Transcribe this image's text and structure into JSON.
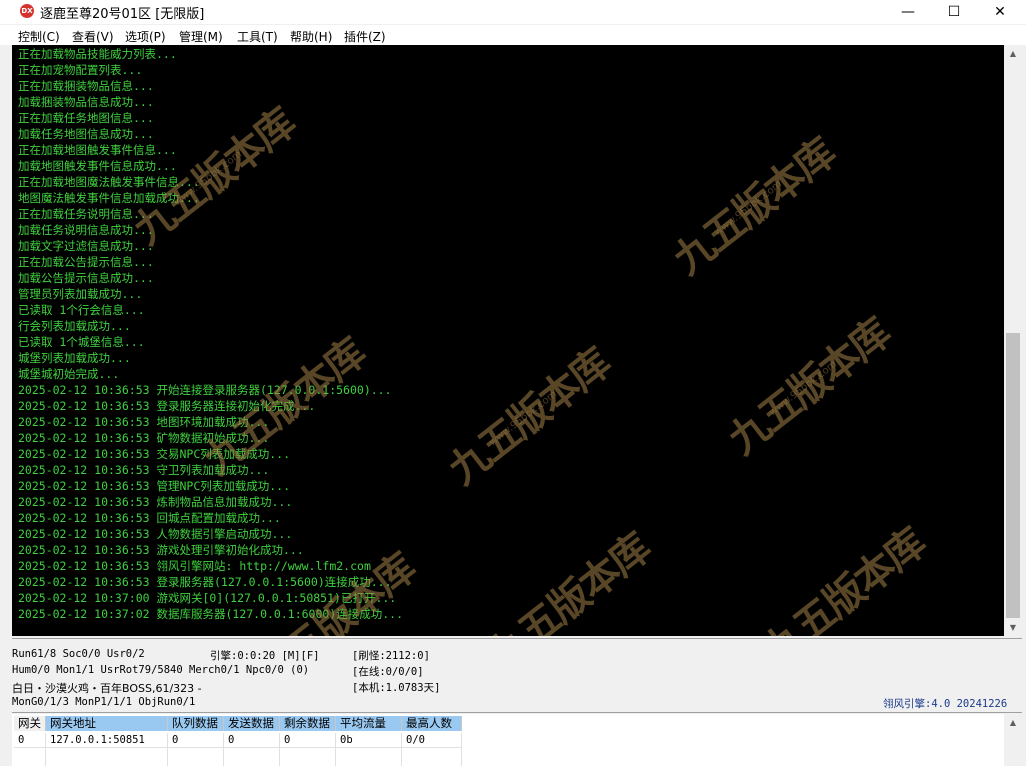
{
  "window": {
    "title": "逐鹿至尊20号01区 [无限版]",
    "icon_label": "DX",
    "minimize": "—",
    "maximize": "☐",
    "close": "✕"
  },
  "menu": [
    {
      "label": "控制(C)"
    },
    {
      "label": "查看(V)"
    },
    {
      "label": "选项(P)"
    },
    {
      "label": "管理(M)"
    },
    {
      "label": "工具(T)"
    },
    {
      "label": "帮助(H)"
    },
    {
      "label": "插件(Z)"
    }
  ],
  "log": [
    "正在加载物品技能威力列表...",
    "正在加宠物配置列表...",
    "正在加载捆装物品信息...",
    "加载捆装物品信息成功...",
    "正在加载任务地图信息...",
    "加载任务地图信息成功...",
    "正在加载地图触发事件信息...",
    "加载地图触发事件信息成功...",
    "正在加载地图魔法触发事件信息...",
    "地图魔法触发事件信息加载成功...",
    "正在加载任务说明信息...",
    "加载任务说明信息成功...",
    "加载文字过滤信息成功...",
    "正在加载公告提示信息...",
    "加载公告提示信息成功...",
    "管理员列表加载成功...",
    "已读取 1个行会信息...",
    "行会列表加载成功...",
    "已读取 1个城堡信息...",
    "城堡列表加载成功...",
    "城堡城初始完成...",
    "2025-02-12 10:36:53 开始连接登录服务器(127.0.0.1:5600)...",
    "2025-02-12 10:36:53 登录服务器连接初始化完成...",
    "2025-02-12 10:36:53 地图环境加载成功...",
    "2025-02-12 10:36:53 矿物数据初始成功...",
    "2025-02-12 10:36:53 交易NPC列表加载成功...",
    "2025-02-12 10:36:53 守卫列表加载成功...",
    "2025-02-12 10:36:53 管理NPC列表加载成功...",
    "2025-02-12 10:36:53 炼制物品信息加载成功...",
    "2025-02-12 10:36:53 回城点配置加载成功...",
    "2025-02-12 10:36:53 人物数据引擎启动成功...",
    "2025-02-12 10:36:53 游戏处理引擎初始化成功...",
    "2025-02-12 10:36:53 翎风引擎网站: http://www.lfm2.com",
    "2025-02-12 10:36:53 登录服务器(127.0.0.1:5600)连接成功...",
    "2025-02-12 10:37:00 游戏网关[0](127.0.0.1:50851)已打开...",
    "2025-02-12 10:37:02 数据库服务器(127.0.0.1:6000)连接成功..."
  ],
  "watermark": {
    "text": "九五版本库",
    "url": "www.95bbk.com",
    "color": "#a08048"
  },
  "status": {
    "line1_left": "Run61/8 Soc0/0 Usr0/2",
    "line1_mid": "引擎:0:0:20 [M][F]",
    "line1_right": "[刷怪:2112:0]",
    "line2_left": "Hum0/0 Mon1/1 UsrRot79/5840 Merch0/1 Npc0/0 (0)",
    "line2_right": "[在线:0/0/0]",
    "line3_left": "白日・沙漠火鸡・百年BOSS,61/323 -",
    "line3_right": "[本机:1.0783天]",
    "line4_left": "MonG0/1/3 MonP1/1/1 ObjRun0/1",
    "version": "翎风引擎:4.0 20241226"
  },
  "grid": {
    "headers": [
      "网关",
      "网关地址",
      "队列数据",
      "发送数据",
      "剩余数据",
      "平均流量",
      "最高人数"
    ],
    "rows": [
      [
        "0",
        "127.0.0.1:50851",
        "0",
        "0",
        "0",
        "0b",
        "0/0"
      ]
    ]
  },
  "colors": {
    "console_bg": "#000000",
    "console_text": "#3fd13f",
    "selected_header": "#99c8f0",
    "version_text": "#1a3a8a"
  }
}
